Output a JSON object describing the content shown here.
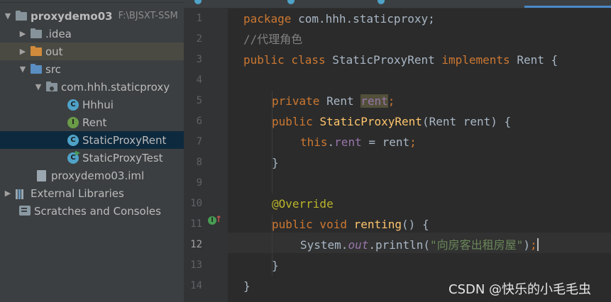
{
  "project_tree": {
    "root": {
      "name": "proxydemo03",
      "path": "F:\\BJSXT-SSM"
    },
    "idea": ".idea",
    "out": "out",
    "src": "src",
    "package": "com.hhh.staticproxy",
    "classes": [
      "Hhhui",
      "Rent",
      "StaticProxyRent",
      "StaticProxyTest"
    ],
    "iml": "proxydemo03.iml",
    "external_libraries": "External Libraries",
    "scratches": "Scratches and Consoles"
  },
  "editor": {
    "line_numbers": [
      "1",
      "2",
      "3",
      "4",
      "5",
      "6",
      "7",
      "8",
      "9",
      "10",
      "11",
      "12",
      "13",
      "14"
    ],
    "current_line": "12",
    "lines": {
      "l1_kw": "package",
      "l1_rest": " com.hhh.staticproxy;",
      "l2_comment": "//代理角色",
      "l3_kw1": "public class",
      "l3_name": " StaticProxyRent ",
      "l3_kw2": "implements",
      "l3_rest": " Rent {",
      "l5_kw": "private",
      "l5_type": " Rent ",
      "l5_field": "rent",
      "l5_semi": ";",
      "l6_kw": "public",
      "l6_fn": "StaticProxyRent",
      "l6_rest": "(Rent rent) {",
      "l7_this": "this",
      "l7_dot": ".",
      "l7_field": "rent",
      "l7_rest": " = rent",
      "l7_semi": ";",
      "l8_brace": "}",
      "l10_ann": "@Override",
      "l11_kw": "public void",
      "l11_fn": "renting",
      "l11_rest": "() {",
      "l12_sys": "System.",
      "l12_out": "out",
      "l12_call": ".println(",
      "l12_str": "\"向房客出租房屋\"",
      "l12_close": ")",
      "l12_semi": ";",
      "l13_brace": "}",
      "l14_brace": "}"
    }
  },
  "watermark": "CSDN @快乐的小毛毛虫"
}
